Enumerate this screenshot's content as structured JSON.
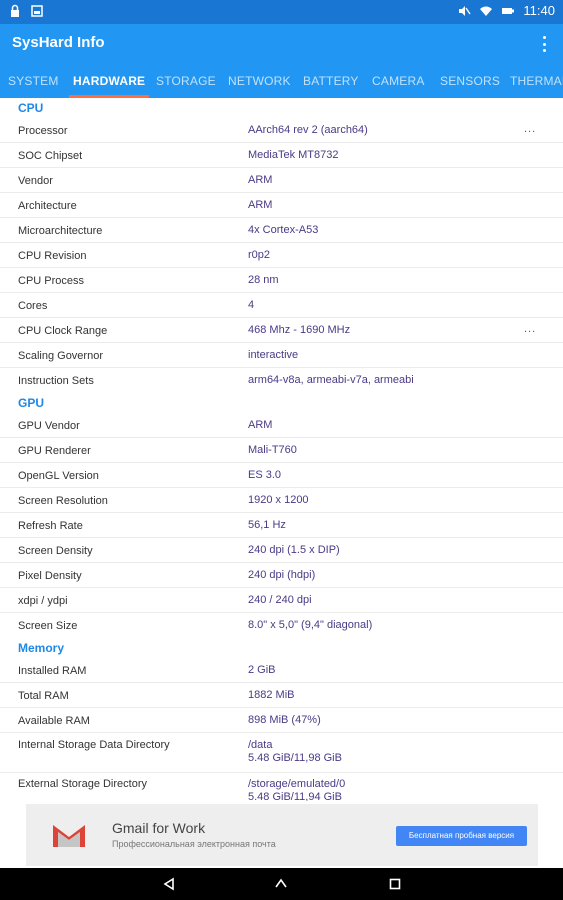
{
  "status_bar": {
    "time": "11:40",
    "left_icons": [
      "lock-icon",
      "image-icon"
    ],
    "right_icons": [
      "mute-icon",
      "wifi-icon",
      "battery-icon"
    ]
  },
  "app_bar": {
    "title": "SysHard Info",
    "overflow_icon": "more-vert-icon"
  },
  "tabs": [
    {
      "label": "SYSTEM",
      "active": false
    },
    {
      "label": "HARDWARE",
      "active": true
    },
    {
      "label": "STORAGE",
      "active": false
    },
    {
      "label": "NETWORK",
      "active": false
    },
    {
      "label": "BATTERY",
      "active": false
    },
    {
      "label": "CAMERA",
      "active": false
    },
    {
      "label": "SENSORS",
      "active": false
    },
    {
      "label": "THERMAL",
      "active": false
    }
  ],
  "sections": {
    "cpu": {
      "title": "CPU",
      "rows": [
        {
          "label": "Processor",
          "value": "AArch64 rev 2 (aarch64)",
          "more": "..."
        },
        {
          "label": "SOC Chipset",
          "value": "MediaTek MT8732"
        },
        {
          "label": "Vendor",
          "value": "ARM"
        },
        {
          "label": "Architecture",
          "value": "ARM"
        },
        {
          "label": "Microarchitecture",
          "value": "4x Cortex-A53"
        },
        {
          "label": "CPU Revision",
          "value": "r0p2"
        },
        {
          "label": "CPU Process",
          "value": "28 nm"
        },
        {
          "label": "Cores",
          "value": "4"
        },
        {
          "label": "CPU Clock Range",
          "value": "468 Mhz - 1690 MHz",
          "more": "..."
        },
        {
          "label": "Scaling Governor",
          "value": "interactive"
        },
        {
          "label": "Instruction Sets",
          "value": "arm64-v8a, armeabi-v7a, armeabi"
        }
      ]
    },
    "gpu": {
      "title": "GPU",
      "rows": [
        {
          "label": "GPU Vendor",
          "value": "ARM"
        },
        {
          "label": "GPU Renderer",
          "value": "Mali-T760"
        },
        {
          "label": "OpenGL Version",
          "value": "ES 3.0"
        },
        {
          "label": "Screen Resolution",
          "value": "1920 x 1200"
        },
        {
          "label": "Refresh Rate",
          "value": "56,1 Hz"
        },
        {
          "label": "Screen Density",
          "value": "240 dpi (1.5 x DIP)"
        },
        {
          "label": "Pixel Density",
          "value": "240 dpi (hdpi)"
        },
        {
          "label": "xdpi / ydpi",
          "value": "240 / 240 dpi"
        },
        {
          "label": "Screen Size",
          "value": "8.0\" x 5,0\" (9,4\" diagonal)"
        }
      ]
    },
    "memory": {
      "title": "Memory",
      "rows": [
        {
          "label": "Installed RAM",
          "value": "2 GiB"
        },
        {
          "label": "Total RAM",
          "value": "1882 MiB"
        },
        {
          "label": "Available RAM",
          "value": "898 MiB (47%)"
        },
        {
          "label": "Internal Storage Data Directory",
          "value": "/data",
          "value2": "5.48 GiB/11,98 GiB"
        },
        {
          "label": "External Storage Directory",
          "value": "/storage/emulated/0",
          "value2": "5.48 GiB/11,94 GiB"
        }
      ]
    }
  },
  "ad": {
    "title": "Gmail for Work",
    "subtitle": "Профессиональная электронная почта",
    "button": "Бесплатная пробная версия",
    "logo_icon": "gmail-logo-icon",
    "logo_colors": {
      "red": "#db4437",
      "grey": "#c5c5c5"
    }
  },
  "nav_bar": {
    "icons": [
      "back-icon",
      "home-icon",
      "recents-icon"
    ]
  },
  "colors": {
    "status_bar": "#1976d2",
    "app_bar": "#2196f3",
    "tab_indicator": "#ff6e40",
    "section_header": "#1e88e5",
    "value_text": "#4a3a86",
    "ad_button": "#4285f4"
  }
}
